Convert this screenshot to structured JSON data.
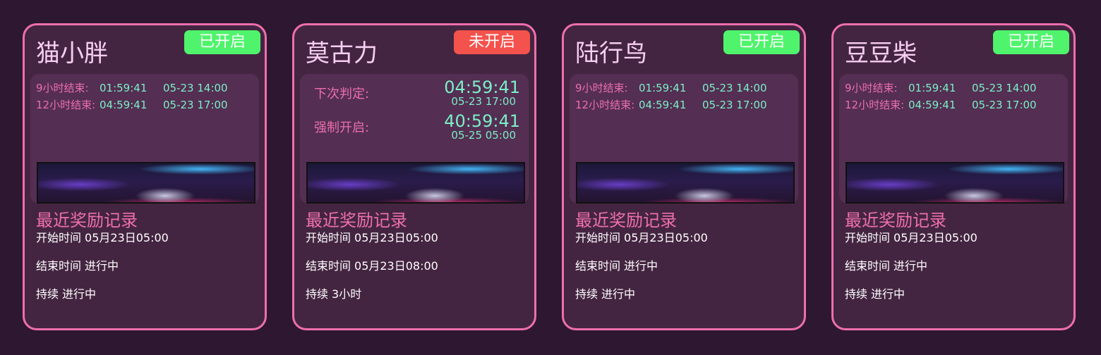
{
  "colors": {
    "background": "#2e1730",
    "card_border": "#ee6fad",
    "badge_on": "#4ff46c",
    "badge_off": "#f4524d",
    "accent_pink": "#e96fae",
    "accent_teal": "#7af0c6"
  },
  "cards": [
    {
      "title": "猫小胖",
      "status": "已开启",
      "timers": [
        {
          "label": "9小时结束:",
          "countdown": "01:59:41",
          "date": "05-23 14:00"
        },
        {
          "label": "12小时结束:",
          "countdown": "04:59:41",
          "date": "05-23 17:00"
        }
      ],
      "banner_icon": "dragon-banner-image",
      "record_title": "最近奖励记录",
      "start_label": "开始时间",
      "start_value": "05月23日05:00",
      "end_label": "结束时间",
      "end_value": "进行中",
      "duration_label": "持续",
      "duration_value": "进行中"
    },
    {
      "title": "莫古力",
      "status": "未开启",
      "judge": {
        "next_label": "下次判定:",
        "next_time": "04:59:41",
        "next_date": "05-23 17:00",
        "force_label": "强制开启:",
        "force_time": "40:59:41",
        "force_date": "05-25 05:00"
      },
      "banner_icon": "dragon-banner-image",
      "record_title": "最近奖励记录",
      "start_label": "开始时间",
      "start_value": "05月23日05:00",
      "end_label": "结束时间",
      "end_value": "05月23日08:00",
      "duration_label": "持续",
      "duration_value": "3小时"
    },
    {
      "title": "陆行鸟",
      "status": "已开启",
      "timers": [
        {
          "label": "9小时结束:",
          "countdown": "01:59:41",
          "date": "05-23 14:00"
        },
        {
          "label": "12小时结束:",
          "countdown": "04:59:41",
          "date": "05-23 17:00"
        }
      ],
      "banner_icon": "dragon-banner-image",
      "record_title": "最近奖励记录",
      "start_label": "开始时间",
      "start_value": "05月23日05:00",
      "end_label": "结束时间",
      "end_value": "进行中",
      "duration_label": "持续",
      "duration_value": "进行中"
    },
    {
      "title": "豆豆柴",
      "status": "已开启",
      "timers": [
        {
          "label": "9小时结束:",
          "countdown": "01:59:41",
          "date": "05-23 14:00"
        },
        {
          "label": "12小时结束:",
          "countdown": "04:59:41",
          "date": "05-23 17:00"
        }
      ],
      "banner_icon": "dragon-banner-image",
      "record_title": "最近奖励记录",
      "start_label": "开始时间",
      "start_value": "05月23日05:00",
      "end_label": "结束时间",
      "end_value": "进行中",
      "duration_label": "持续",
      "duration_value": "进行中"
    }
  ]
}
